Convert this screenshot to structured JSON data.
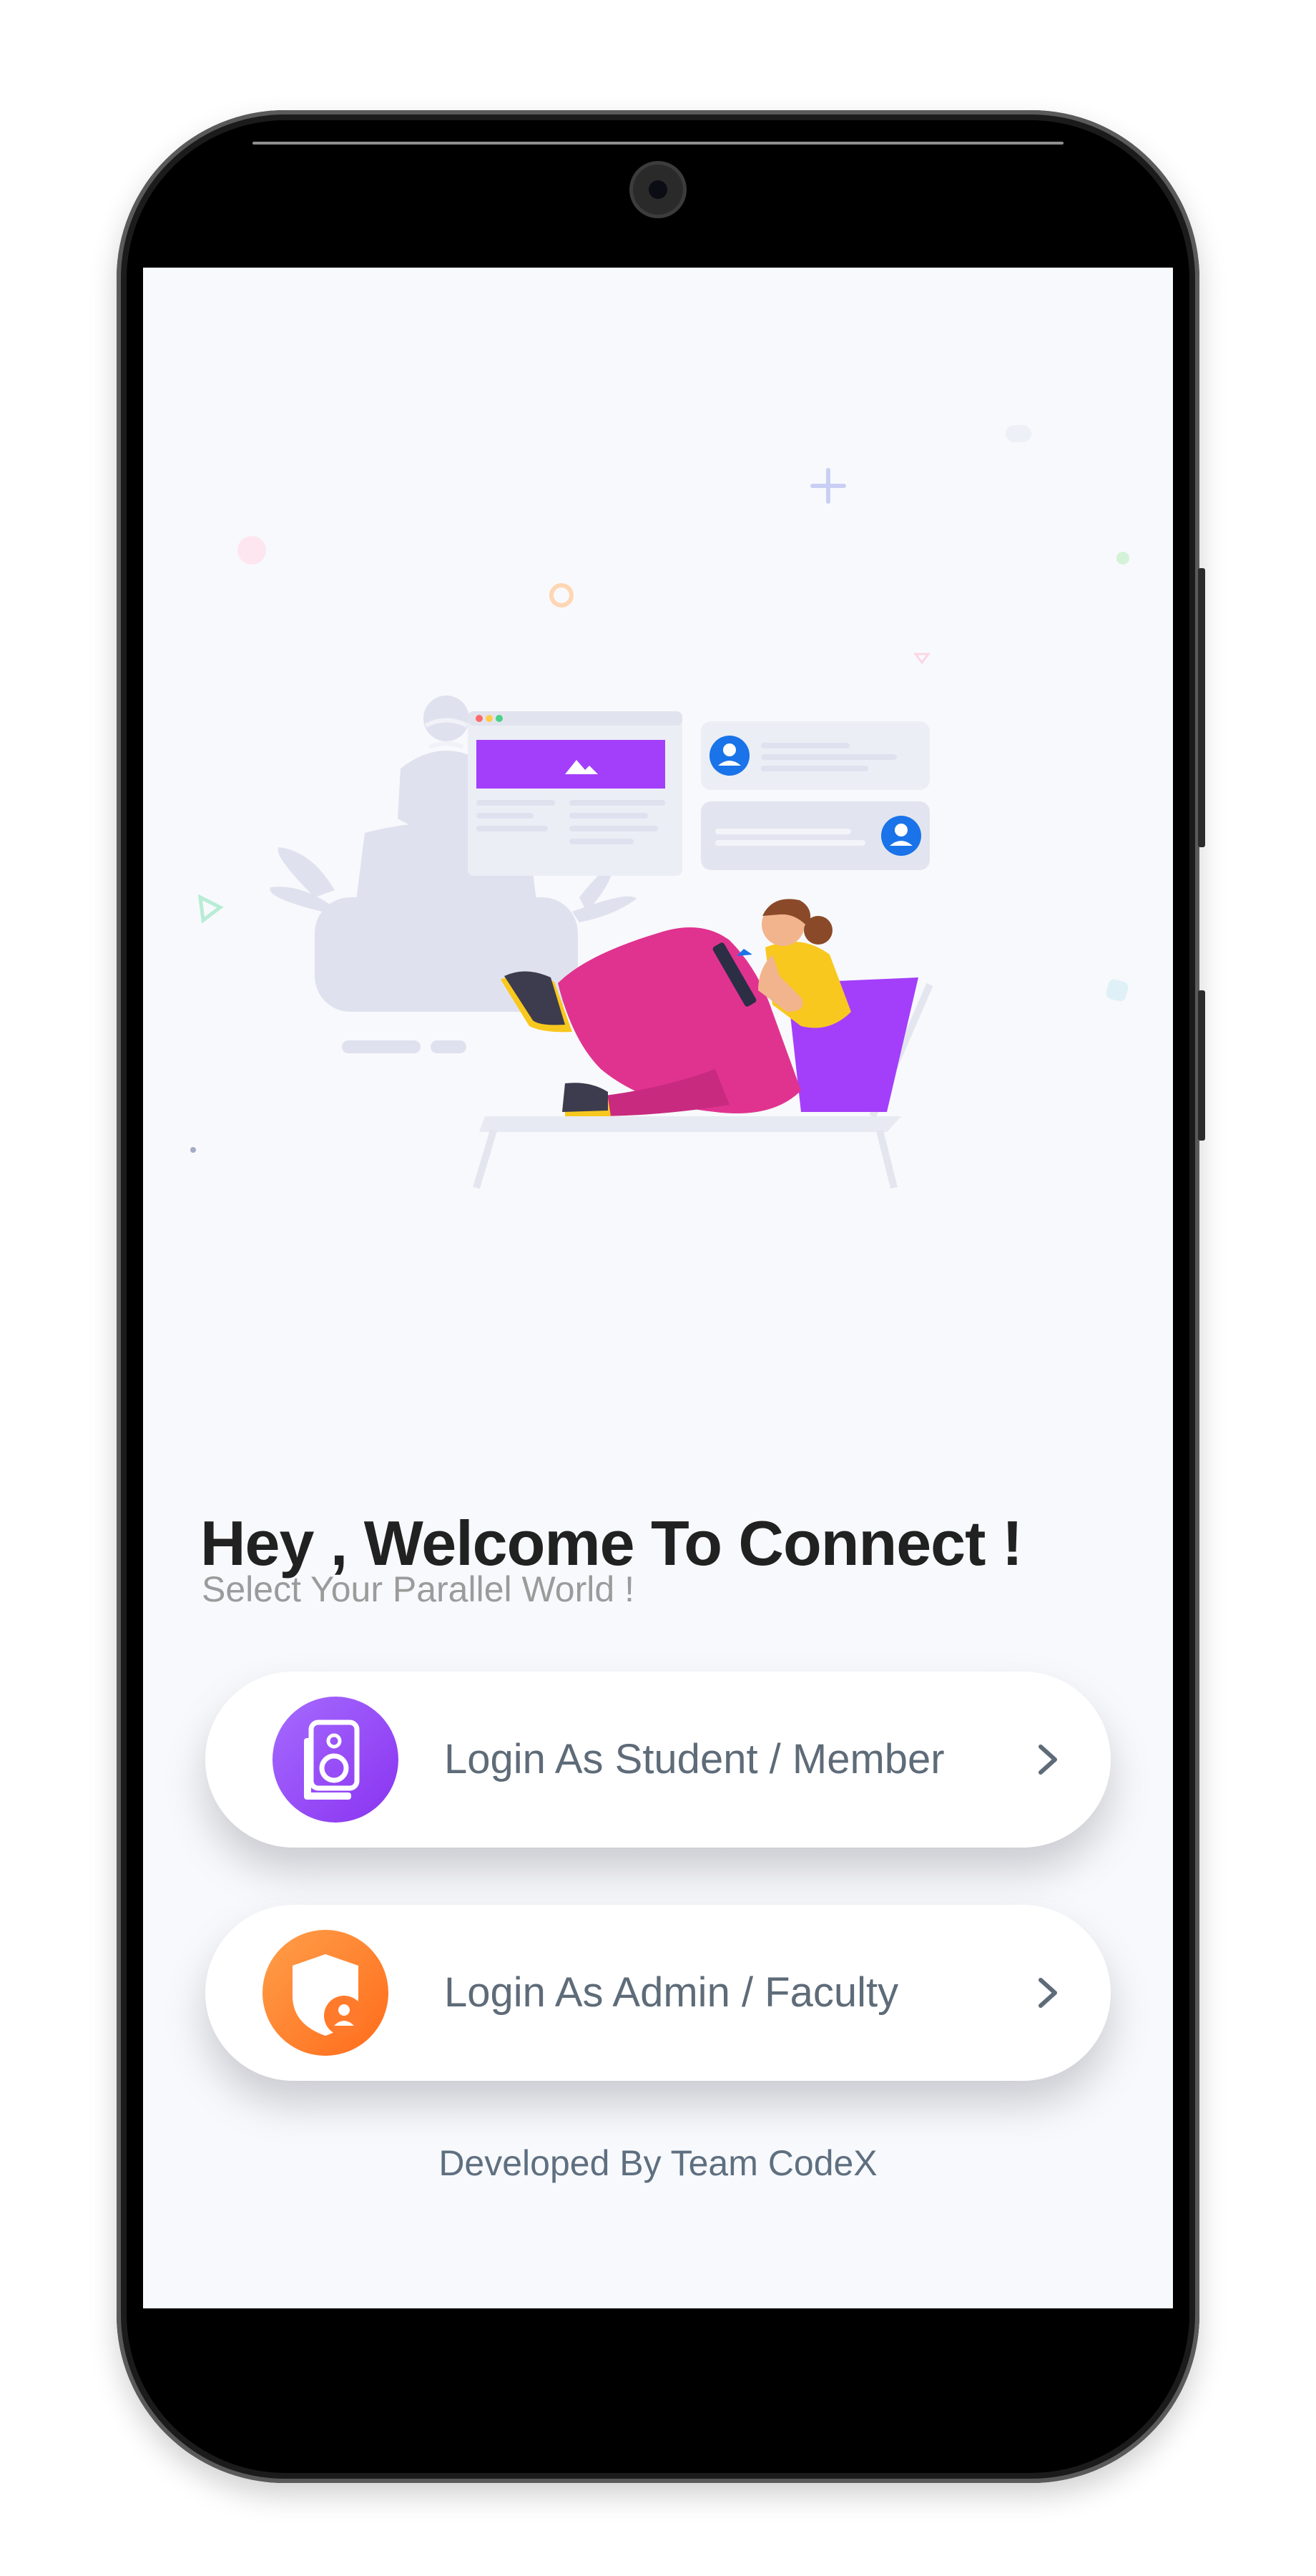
{
  "welcome": {
    "title": "Hey , Welcome To Connect !",
    "subtitle": "Select Your Parallel World !"
  },
  "options": [
    {
      "label": "Login As Student / Member",
      "icon": "student-badge-icon",
      "color": "#9b4dff"
    },
    {
      "label": "Login As Admin / Faculty",
      "icon": "admin-shield-icon",
      "color": "#ff7a2a"
    }
  ],
  "footer": {
    "credit": "Developed By Team CodeX"
  },
  "colors": {
    "background": "#f8f9fc",
    "title": "#212121",
    "subtitle": "#9b9b9b",
    "label": "#5e6b78",
    "illustration_accent": "#9b3dff",
    "illustration_pink": "#e0338f",
    "illustration_yellow": "#f8c81e"
  }
}
